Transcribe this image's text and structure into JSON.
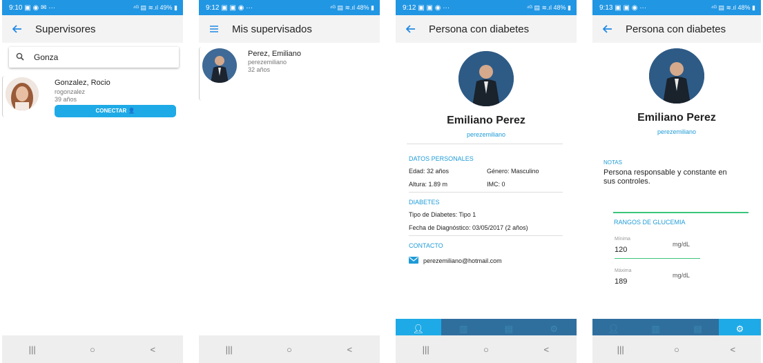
{
  "colors": {
    "status_bar": "#2196e3",
    "accent": "#1e9bd7",
    "button": "#1eaae6",
    "bottom_nav": "#2f6f9e"
  },
  "screens": [
    {
      "status": {
        "time": "9:10 ▣ ◉ ✉ ···",
        "right": "⁴ᴳ ▤ ≋.ıl 49% ▮"
      },
      "appbar": {
        "nav_icon": "back-arrow-icon",
        "title": "Supervisores"
      },
      "search": {
        "icon": "search-icon",
        "value": "Gonza"
      },
      "result": {
        "name": "Gonzalez, Rocio",
        "username": "rogonzalez",
        "age": "39 años",
        "button": "CONECTAR"
      }
    },
    {
      "status": {
        "time": "9:12 ▣ ▣ ◉ ···",
        "right": "⁴ᴳ ▤ ≋.ıl 48% ▮"
      },
      "appbar": {
        "nav_icon": "menu-icon",
        "title": "Mis supervisados"
      },
      "item": {
        "name": "Perez, Emiliano",
        "username": "perezemiliano",
        "age": "32 años"
      }
    },
    {
      "status": {
        "time": "9:12 ▣ ▣ ◉ ···",
        "right": "⁴ᴳ ▤ ≋.ıl 48% ▮"
      },
      "appbar": {
        "nav_icon": "back-arrow-icon",
        "title": "Persona con diabetes"
      },
      "profile": {
        "name": "Emiliano Perez",
        "username": "perezemiliano"
      },
      "personal": {
        "heading": "DATOS PERSONALES",
        "edad": "Edad: 32 años",
        "genero": "Género: Masculino",
        "altura": "Altura: 1.89 m",
        "imc": "IMC: 0"
      },
      "diabetes": {
        "heading": "DIABETES",
        "tipo": "Tipo de Diabetes: Tipo 1",
        "fecha": "Fecha de Diagnóstico: 03/05/2017 (2 años)"
      },
      "contacto": {
        "heading": "CONTACTO",
        "email": "perezemiliano@hotmail.com"
      },
      "active_tab": 0
    },
    {
      "status": {
        "time": "9:13 ▣ ▣ ◉ ···",
        "right": "⁴ᴳ ▤ ≋.ıl 48% ▮"
      },
      "appbar": {
        "nav_icon": "back-arrow-icon",
        "title": "Persona con diabetes"
      },
      "profile": {
        "name": "Emiliano Perez",
        "username": "perezemiliano"
      },
      "notas": {
        "label": "NOTAS",
        "text_1": "Persona responsable y constante en",
        "text_2": "sus controles."
      },
      "glucemia": {
        "heading": "RANGOS DE GLUCEMIA",
        "min_label": "Mínima",
        "min_value": "120",
        "max_label": "Máxima",
        "max_value": "189",
        "unit": "mg/dL"
      },
      "active_tab": 3
    }
  ],
  "navbar": {
    "recents": "|||",
    "home": "○",
    "back": "<"
  }
}
